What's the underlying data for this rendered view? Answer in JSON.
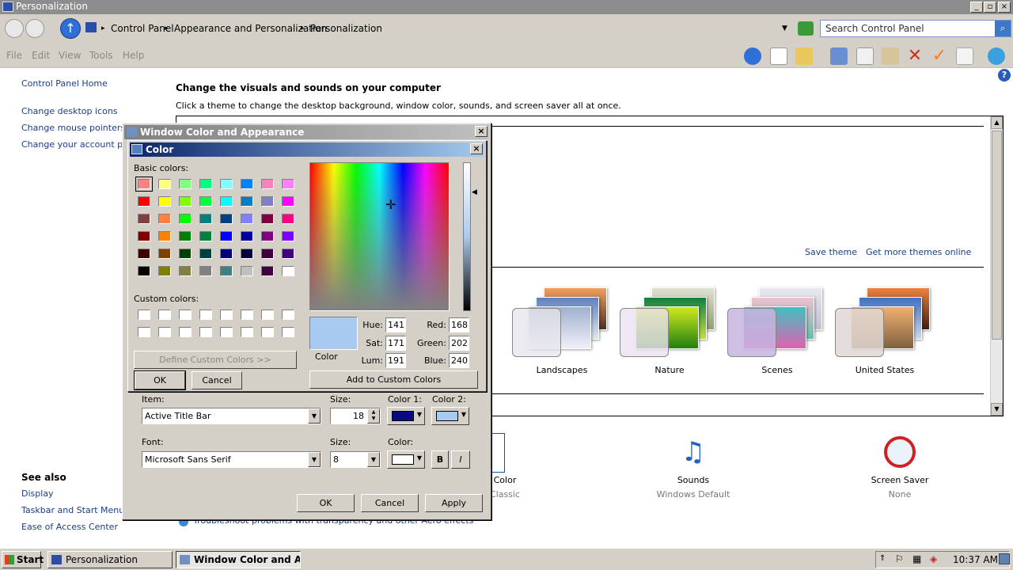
{
  "window": {
    "title": "Personalization",
    "breadcrumbs": [
      "Control Panel",
      "Appearance and Personalization",
      "Personalization"
    ],
    "search_placeholder": "Search Control Panel"
  },
  "menu": [
    "File",
    "Edit",
    "View",
    "Tools",
    "Help"
  ],
  "sidebar": {
    "links": [
      "Control Panel Home",
      "Change desktop icons",
      "Change mouse pointers",
      "Change your account pictu"
    ],
    "see_also_title": "See also",
    "see_also": [
      "Display",
      "Taskbar and Start Menu",
      "Ease of Access Center"
    ]
  },
  "content": {
    "heading": "Change the visuals and sounds on your computer",
    "subheading": "Click a theme to change the desktop background, window color, sounds, and screen saver all at once.",
    "save_theme": "Save theme",
    "get_more": "Get more themes online",
    "themes": [
      "Landscapes",
      "Nature",
      "Scenes",
      "United States"
    ],
    "bottom": [
      {
        "label": "Color",
        "sub": "Classic"
      },
      {
        "label": "Sounds",
        "sub": "Windows Default"
      },
      {
        "label": "Screen Saver",
        "sub": "None"
      }
    ],
    "troubleshoot": "Troubleshoot problems with transparency and other Aero effects"
  },
  "wca_dialog": {
    "title": "Window Color and Appearance",
    "item_label": "Item:",
    "item_value": "Active Title Bar",
    "size_label": "Size:",
    "size_value": "18",
    "color1_label": "Color 1:",
    "color2_label": "Color 2:",
    "color1": "#0a0a80",
    "color2": "#a8caf0",
    "font_label": "Font:",
    "font_value": "Microsoft Sans Serif",
    "font_size_label": "Size:",
    "font_size_value": "8",
    "font_color_label": "Color:",
    "font_color": "#ffffff",
    "bold": "B",
    "italic": "I",
    "ok": "OK",
    "cancel": "Cancel",
    "apply": "Apply"
  },
  "color_dialog": {
    "title": "Color",
    "basic_label": "Basic colors:",
    "custom_label": "Custom colors:",
    "define_custom": "Define Custom Colors >>",
    "ok": "OK",
    "cancel": "Cancel",
    "add_custom": "Add to Custom Colors",
    "preview_label": "Color",
    "preview_color": "#a8caf0",
    "hue_label": "Hue:",
    "hue": "141",
    "sat_label": "Sat:",
    "sat": "171",
    "lum_label": "Lum:",
    "lum": "191",
    "red_label": "Red:",
    "red": "168",
    "green_label": "Green:",
    "green": "202",
    "blue_label": "Blue:",
    "blue": "240",
    "basic_colors": [
      "#ff8080",
      "#ffff80",
      "#80ff80",
      "#00ff80",
      "#80ffff",
      "#0080ff",
      "#ff80c0",
      "#ff80ff",
      "#ff0000",
      "#ffff00",
      "#80ff00",
      "#00ff40",
      "#00ffff",
      "#0080c0",
      "#8080c0",
      "#ff00ff",
      "#804040",
      "#ff8040",
      "#00ff00",
      "#008080",
      "#004080",
      "#8080ff",
      "#800040",
      "#ff0080",
      "#800000",
      "#ff8000",
      "#008000",
      "#008040",
      "#0000ff",
      "#0000a0",
      "#800080",
      "#8000ff",
      "#400000",
      "#804000",
      "#004000",
      "#004040",
      "#000080",
      "#000040",
      "#400040",
      "#400080",
      "#000000",
      "#808000",
      "#808040",
      "#808080",
      "#408080",
      "#c0c0c0",
      "#400040",
      "#ffffff"
    ]
  },
  "taskbar": {
    "start": "Start",
    "tasks": [
      "Personalization",
      "Window Color and A..."
    ],
    "clock": "10:37 AM"
  }
}
